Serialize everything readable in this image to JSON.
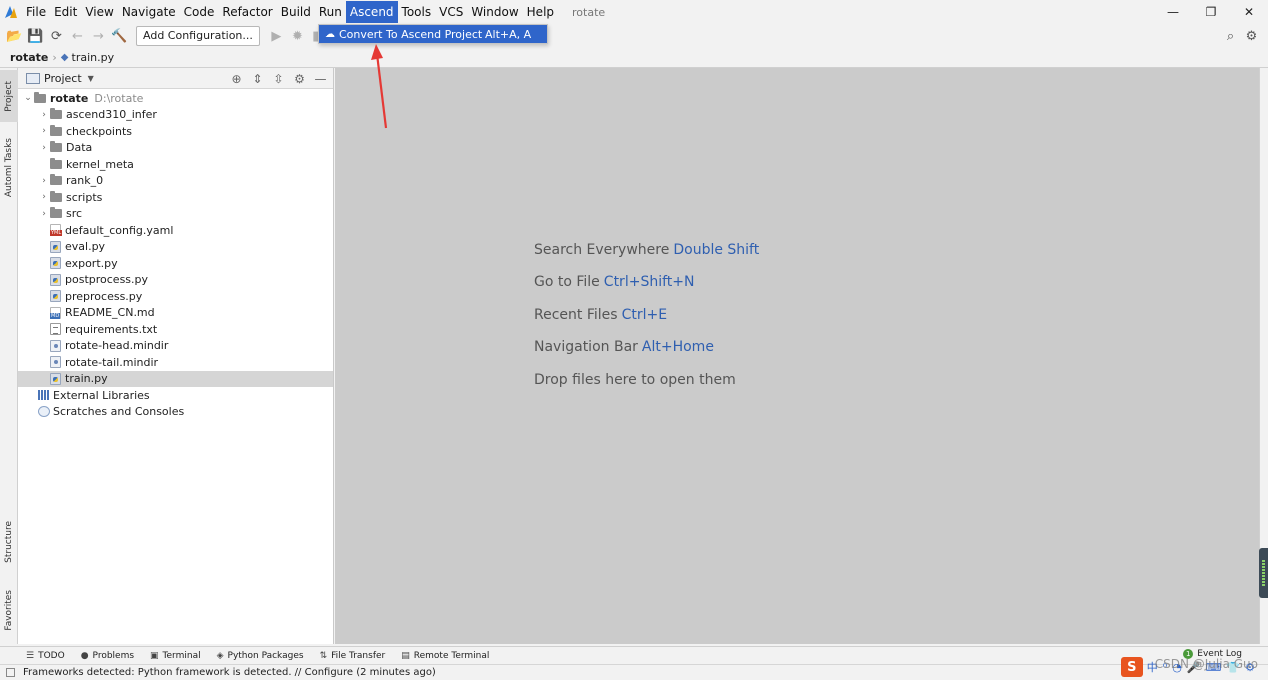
{
  "menubar": {
    "items": [
      "File",
      "Edit",
      "View",
      "Navigate",
      "Code",
      "Refactor",
      "Build",
      "Run",
      "Ascend",
      "Tools",
      "VCS",
      "Window",
      "Help"
    ],
    "active_index": 8,
    "window_title": "rotate",
    "controls": {
      "minimize": "—",
      "restore": "❐",
      "close": "✕"
    }
  },
  "dropdown": {
    "item_label": "Convert To Ascend Project",
    "item_shortcut": "Alt+A, A",
    "item_icon": "cloud-icon"
  },
  "toolbar": {
    "add_configuration": "Add Configuration..."
  },
  "breadcrumb": {
    "root": "rotate",
    "file": "train.py"
  },
  "left_stripe": {
    "project": "Project",
    "automl": "Automl Tasks",
    "structure": "Structure",
    "favorites": "Favorites"
  },
  "project_panel": {
    "title": "Project",
    "root": {
      "name": "rotate",
      "path": "D:\\rotate"
    },
    "tree": [
      {
        "name": "ascend310_infer",
        "kind": "folder",
        "expandable": true
      },
      {
        "name": "checkpoints",
        "kind": "folder",
        "expandable": true
      },
      {
        "name": "Data",
        "kind": "folder",
        "expandable": true
      },
      {
        "name": "kernel_meta",
        "kind": "folder",
        "expandable": false
      },
      {
        "name": "rank_0",
        "kind": "folder",
        "expandable": true
      },
      {
        "name": "scripts",
        "kind": "folder",
        "expandable": true
      },
      {
        "name": "src",
        "kind": "folder",
        "expandable": true
      },
      {
        "name": "default_config.yaml",
        "kind": "yml"
      },
      {
        "name": "eval.py",
        "kind": "py"
      },
      {
        "name": "export.py",
        "kind": "py"
      },
      {
        "name": "postprocess.py",
        "kind": "py"
      },
      {
        "name": "preprocess.py",
        "kind": "py"
      },
      {
        "name": "README_CN.md",
        "kind": "md"
      },
      {
        "name": "requirements.txt",
        "kind": "txt"
      },
      {
        "name": "rotate-head.mindir",
        "kind": "mind"
      },
      {
        "name": "rotate-tail.mindir",
        "kind": "mind"
      },
      {
        "name": "train.py",
        "kind": "py",
        "selected": true
      }
    ],
    "external_libraries": "External Libraries",
    "scratches": "Scratches and Consoles"
  },
  "editor_hints": [
    {
      "text": "Search Everywhere",
      "key": "Double Shift"
    },
    {
      "text": "Go to File",
      "key": "Ctrl+Shift+N"
    },
    {
      "text": "Recent Files",
      "key": "Ctrl+E"
    },
    {
      "text": "Navigation Bar",
      "key": "Alt+Home"
    },
    {
      "text": "Drop files here to open them",
      "key": ""
    }
  ],
  "bottom_tools": {
    "todo": "TODO",
    "problems": "Problems",
    "terminal": "Terminal",
    "python_packages": "Python Packages",
    "file_transfer": "File Transfer",
    "remote_terminal": "Remote Terminal",
    "event_log": "Event Log",
    "event_count": "1"
  },
  "statusbar": {
    "message": "Frameworks detected: Python framework is detected. // Configure (2 minutes ago)"
  },
  "ime": {
    "logo": "S",
    "items": [
      "中",
      "⁰",
      "◔",
      "🎤",
      "⌨",
      "👕",
      "⚙"
    ]
  },
  "watermark": "CSDN @Julia Guo",
  "colors": {
    "accent": "#2f65ca",
    "editor_bg": "#cbcbcb",
    "hint_key": "#2f5fb0",
    "annotation_arrow": "#e53935"
  }
}
